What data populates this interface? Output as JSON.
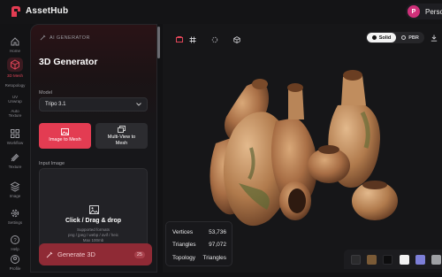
{
  "app": {
    "brand": "AssetHub",
    "user_initial": "P",
    "user_name": "Person"
  },
  "rail": [
    {
      "label": "Home",
      "icon": "home-icon"
    },
    {
      "label": "3D Mesh",
      "icon": "cube-icon",
      "active": true
    },
    {
      "label": "Retopology",
      "icon": "retopology-icon"
    },
    {
      "label": "UV Unwrap",
      "icon": "uv-unwrap-icon"
    },
    {
      "label": "Auto Texture",
      "icon": "auto-texture-icon"
    },
    {
      "label": "Workflow",
      "icon": "workflow-icon"
    },
    {
      "label": "Texture",
      "icon": "texture-icon"
    },
    {
      "label": "Image",
      "icon": "image-icon"
    },
    {
      "label": "Settings",
      "icon": "gear-icon"
    },
    {
      "label": "Help",
      "icon": "help-icon"
    },
    {
      "label": "Profile",
      "icon": "profile-icon"
    }
  ],
  "panel": {
    "tag": "AI GENERATOR",
    "title": "3D Generator",
    "model_label": "Model",
    "model_value": "Tripo 3.1",
    "modes": [
      "Image to Mesh",
      "Multi-View to Mesh"
    ],
    "input_label": "Input Image",
    "drop_title": "Click / Drag & drop",
    "drop_formats_label": "Supported formats",
    "drop_formats": "png / jpeg / webp / avif / heic",
    "drop_max": "Max 100mb",
    "generate_label": "Generate 3D",
    "generate_cost": "25"
  },
  "viewport": {
    "render_modes": [
      "Solid",
      "PBR"
    ],
    "selected_render_mode": "Solid",
    "stats": [
      {
        "label": "Vertices",
        "value": "53,736"
      },
      {
        "label": "Triangles",
        "value": "97,072"
      },
      {
        "label": "Topology",
        "value": "Triangles"
      }
    ],
    "swatches": [
      "#2b2b2d",
      "#7a5a36",
      "#0d0d0e",
      "#f2f2f2",
      "#7d7fd8",
      "#9ea0a4"
    ]
  },
  "colors": {
    "accent": "#e33c52",
    "background": "#121214",
    "panel": "#17171a"
  }
}
